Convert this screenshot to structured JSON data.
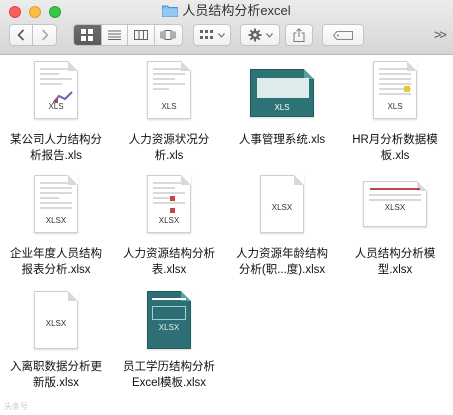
{
  "window": {
    "title": "人员结构分析excel"
  },
  "toolbar": {
    "back_icon": "chevron-left-icon",
    "forward_icon": "chevron-right-icon",
    "view_modes": [
      "icon-view-icon",
      "list-view-icon",
      "column-view-icon",
      "cover-flow-icon"
    ],
    "more_label": ">>"
  },
  "files": [
    {
      "name": "某公司人力结构分\n析报告.xls",
      "ext": "XLS"
    },
    {
      "name": "人力资源状况分\n析.xls",
      "ext": "XLS"
    },
    {
      "name": "人事管理系统.xls",
      "ext": "XLS"
    },
    {
      "name": "HR月分析数据模\n板.xls",
      "ext": "XLS"
    },
    {
      "name": "企业年度人员结构\n报表分析.xlsx",
      "ext": "XLSX"
    },
    {
      "name": "人力资源结构分析\n表.xlsx",
      "ext": "XLSX"
    },
    {
      "name": "人力资源年龄结构\n分析(职...度).xlsx",
      "ext": "XLSX"
    },
    {
      "name": "人员结构分析模\n型.xlsx",
      "ext": "XLSX"
    },
    {
      "name": "入离职数据分析更\n新版.xlsx",
      "ext": "XLSX"
    },
    {
      "name": "员工学历结构分析\nExcel模板.xlsx",
      "ext": "XLSX"
    }
  ],
  "watermark": "头条号"
}
